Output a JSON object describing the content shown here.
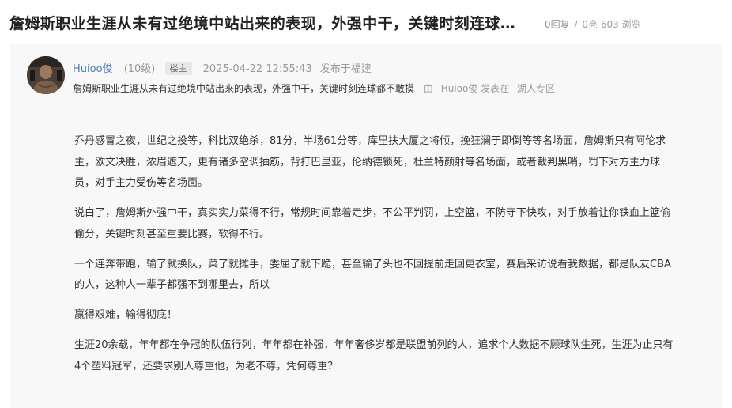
{
  "thread": {
    "title": "詹姆斯职业生涯从未有过绝境中站出来的表现，外强中干，关键时刻连球…",
    "replies": "0回复",
    "separator": "/",
    "likes": "0亮",
    "views": "603 浏览"
  },
  "post": {
    "username": "Huioo俊",
    "level": "(10级)",
    "op_badge": "楼主",
    "time": "2025-04-22 12:55:43",
    "location": "发布于福建",
    "summary": {
      "text": "詹姆斯职业生涯从未有过绝境中站出来的表现，外强中干，关键时刻连球都不敢摸",
      "by": "由",
      "author": "Huioo俊",
      "posted_in": "发表在",
      "forum": "湖人专区"
    },
    "paragraphs": [
      "乔丹感冒之夜，世纪之投等，科比双绝杀，81分，半场61分等，库里扶大厦之将倾，挽狂澜于即倒等等名场面，詹姆斯只有阿伦求主，欧文决胜，浓眉遮天，更有诸多空调抽筋，背打巴里亚，伦纳德锁死，杜兰特颜射等名场面，或者裁判黑哨，罚下对方主力球员，对手主力受伤等名场面。",
      "说白了，詹姆斯外强中干，真实实力菜得不行，常规时间靠着走步，不公平判罚，上空篮，不防守下快攻，对手放着让你铁血上篮偷偷分，关键时刻甚至重要比赛，软得不行。",
      "一个连奔带跑，输了就换队，菜了就摊手，委屈了就下跪，甚至输了头也不回提前走回更衣室，赛后采访说看我数据，都是队友CBA的人，这种人一辈子都强不到哪里去，所以",
      "赢得艰难，输得彻底！",
      "生涯20余载，年年都在争冠的队伍行列，年年都在补强，年年奢侈岁都是联盟前列的人，追求个人数据不顾球队生死，生涯为止只有4个塑料冠军，还要求别人尊重他，为老不尊，凭何尊重？"
    ]
  }
}
